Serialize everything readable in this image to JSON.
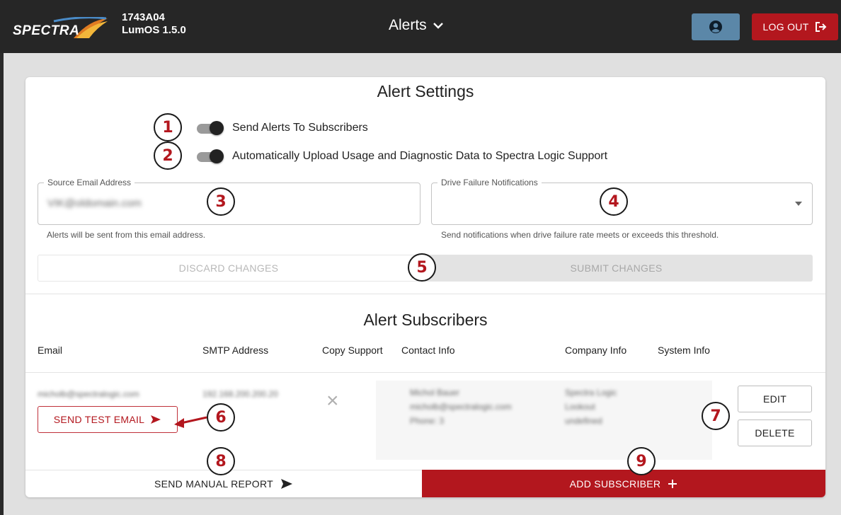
{
  "header": {
    "logo_text": "SPECTRA",
    "system_id": "1743A04",
    "os_version": "LumOS 1.5.0",
    "page_title": "Alerts",
    "logout_label": "LOG OUT",
    "colors": {
      "bar": "#262626",
      "user_button": "#5b87a8",
      "logout_button": "#b3171e"
    }
  },
  "settings": {
    "title": "Alert Settings",
    "toggles": [
      {
        "label": "Send Alerts To Subscribers",
        "on": true
      },
      {
        "label": "Automatically Upload Usage and Diagnostic Data to Spectra Logic Support",
        "on": true
      }
    ],
    "source_email": {
      "legend": "Source Email Address",
      "value": "VIK@oldomain.com",
      "helper": "Alerts will be sent from this email address."
    },
    "drive_failure": {
      "legend": "Drive Failure Notifications",
      "value": "",
      "helper": "Send notifications when drive failure rate meets or exceeds this threshold."
    },
    "discard_label": "DISCARD CHANGES",
    "submit_label": "SUBMIT CHANGES"
  },
  "subscribers": {
    "title": "Alert Subscribers",
    "columns": [
      "Email",
      "SMTP Address",
      "Copy Support",
      "Contact Info",
      "Company Info",
      "System Info"
    ],
    "rows": [
      {
        "email": "micholb@spectralogic.com",
        "smtp": "192.168.200.200.20",
        "copy_support": "×",
        "contact": [
          "Michol Bauer",
          "micholb@spectralogic.com",
          "Phone: 3"
        ],
        "company": [
          "Spectra Logic",
          "Lookout",
          "undefined"
        ],
        "system": "",
        "test_label": "SEND TEST EMAIL",
        "edit_label": "EDIT",
        "delete_label": "DELETE"
      }
    ],
    "manual_report_label": "SEND MANUAL REPORT",
    "add_label": "ADD SUBSCRIBER"
  },
  "callouts": [
    "1",
    "2",
    "3",
    "4",
    "5",
    "6",
    "7",
    "8",
    "9"
  ]
}
